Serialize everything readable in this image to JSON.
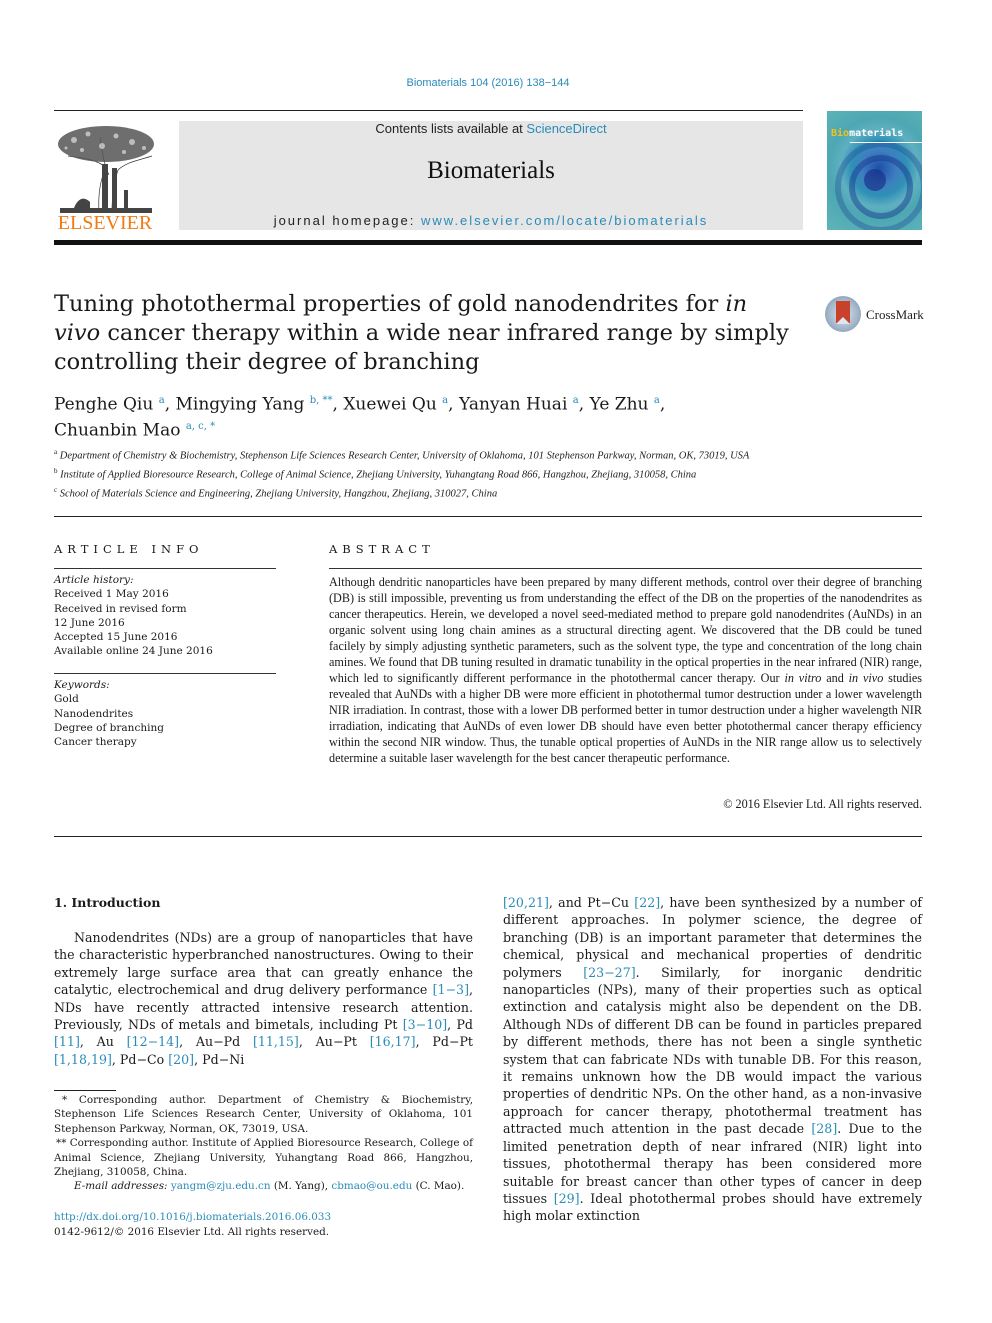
{
  "header": {
    "journal_ref": "Biomaterials 104 (2016) 138−144",
    "contents_prefix": "Contents lists available at ",
    "contents_link": "ScienceDirect",
    "journal_name": "Biomaterials",
    "homepage_prefix": "journal homepage: ",
    "homepage_link": "www.elsevier.com/locate/biomaterials",
    "publisher_logo_text": "ELSEVIER",
    "cover_title_bio": "Bio",
    "cover_title_rest": "materials",
    "crossmark_label": "CrossMark"
  },
  "article": {
    "title_part1": "Tuning photothermal properties of gold nanodendrites for ",
    "title_italic": "in vivo",
    "title_part2": " cancer therapy within a wide near infrared range by simply controlling their degree of branching",
    "authors": [
      {
        "name": "Penghe Qiu",
        "sup": "a"
      },
      {
        "name": "Mingying Yang",
        "sup": "b, **"
      },
      {
        "name": "Xuewei Qu",
        "sup": "a"
      },
      {
        "name": "Yanyan Huai",
        "sup": "a"
      },
      {
        "name": "Ye Zhu",
        "sup": "a"
      },
      {
        "name": "Chuanbin Mao",
        "sup": "a, c, *"
      }
    ],
    "affiliations": [
      {
        "sup": "a",
        "text": "Department of Chemistry & Biochemistry, Stephenson Life Sciences Research Center, University of Oklahoma, 101 Stephenson Parkway, Norman, OK, 73019, USA"
      },
      {
        "sup": "b",
        "text": "Institute of Applied Bioresource Research, College of Animal Science, Zhejiang University, Yuhangtang Road 866, Hangzhou, Zhejiang, 310058, China"
      },
      {
        "sup": "c",
        "text": "School of Materials Science and Engineering, Zhejiang University, Hangzhou, Zhejiang, 310027, China"
      }
    ]
  },
  "article_info": {
    "heading": "ARTICLE INFO",
    "history_label": "Article history:",
    "history": [
      "Received 1 May 2016",
      "Received in revised form",
      "12 June 2016",
      "Accepted 15 June 2016",
      "Available online 24 June 2016"
    ],
    "keywords_label": "Keywords:",
    "keywords": [
      "Gold",
      "Nanodendrites",
      "Degree of branching",
      "Cancer therapy"
    ]
  },
  "abstract": {
    "heading": "ABSTRACT",
    "text_1": "Although dendritic nanoparticles have been prepared by many different methods, control over their degree of branching (DB) is still impossible, preventing us from understanding the effect of the DB on the properties of the nanodendrites as cancer therapeutics. Herein, we developed a novel seed-mediated method to prepare gold nanodendrites (AuNDs) in an organic solvent using long chain amines as a structural directing agent. We discovered that the DB could be tuned facilely by simply adjusting synthetic parameters, such as the solvent type, the type and concentration of the long chain amines. We found that DB tuning resulted in dramatic tunability in the optical properties in the near infrared (NIR) range, which led to significantly different performance in the photothermal cancer therapy. Our ",
    "italic_1": "in vitro",
    "text_2": " and ",
    "italic_2": "in vivo",
    "text_3": " studies revealed that AuNDs with a higher DB were more efficient in photothermal tumor destruction under a lower wavelength NIR irradiation. In contrast, those with a lower DB performed better in tumor destruction under a higher wavelength NIR irradiation, indicating that AuNDs of even lower DB should have even better photothermal cancer therapy efficiency within the second NIR window. Thus, the tunable optical properties of AuNDs in the NIR range allow us to selectively determine a suitable laser wavelength for the best cancer therapeutic performance.",
    "copyright": "© 2016 Elsevier Ltd. All rights reserved."
  },
  "body": {
    "section_heading": "1.  Introduction",
    "left_col": [
      {
        "t": "Nanodendrites (NDs) are a group of nanoparticles that have the characteristic hyperbranched nanostructures. Owing to their extremely large surface area that can greatly enhance the catalytic, electrochemical and drug delivery performance "
      },
      {
        "c": "[1−3]"
      },
      {
        "t": ", NDs have recently attracted intensive research attention. Previously, NDs of metals and bimetals, including Pt "
      },
      {
        "c": "[3−10]"
      },
      {
        "t": ", Pd "
      },
      {
        "c": "[11]"
      },
      {
        "t": ", Au "
      },
      {
        "c": "[12−14]"
      },
      {
        "t": ", Au−Pd "
      },
      {
        "c": "[11,15]"
      },
      {
        "t": ", Au−Pt "
      },
      {
        "c": "[16,17]"
      },
      {
        "t": ", Pd−Pt "
      },
      {
        "c": "[1,18,19]"
      },
      {
        "t": ", Pd−Co "
      },
      {
        "c": "[20]"
      },
      {
        "t": ", Pd−Ni"
      }
    ],
    "right_col": [
      {
        "c": "[20,21]"
      },
      {
        "t": ", and Pt−Cu "
      },
      {
        "c": "[22]"
      },
      {
        "t": ", have been synthesized by a number of different approaches. In polymer science, the degree of branching (DB) is an important parameter that determines the chemical, physical and mechanical properties of dendritic polymers "
      },
      {
        "c": "[23−27]"
      },
      {
        "t": ". Similarly, for inorganic dendritic nanoparticles (NPs), many of their properties such as optical extinction and catalysis might also be dependent on the DB. Although NDs of different DB can be found in particles prepared by different methods, there has not been a single synthetic system that can fabricate NDs with tunable DB. For this reason, it remains unknown how the DB would impact the various properties of dendritic NPs. On the other hand, as a non-invasive approach for cancer therapy, photothermal treatment has attracted much attention in the past decade "
      },
      {
        "c": "[28]"
      },
      {
        "t": ". Due to the limited penetration depth of near infrared (NIR) light into tissues, photothermal therapy has been considered more suitable for breast cancer than other types of cancer in deep tissues "
      },
      {
        "c": "[29]"
      },
      {
        "t": ". Ideal photothermal probes should have extremely high molar extinction"
      }
    ]
  },
  "footnotes": {
    "fn1": "* Corresponding author. Department of Chemistry & Biochemistry, Stephenson Life Sciences Research Center, University of Oklahoma, 101 Stephenson Parkway, Norman, OK, 73019, USA.",
    "fn2": "** Corresponding author. Institute of Applied Bioresource Research, College of Animal Science, Zhejiang University, Yuhangtang Road 866, Hangzhou, Zhejiang, 310058, China.",
    "email_label": "E-mail addresses:",
    "email_1": "yangm@zju.edu.cn",
    "email_1_name": " (M. Yang), ",
    "email_2": "cbmao@ou.edu",
    "email_2_name": " (C. Mao).",
    "doi": "http://dx.doi.org/10.1016/j.biomaterials.2016.06.033",
    "issn": "0142-9612/© 2016 Elsevier Ltd. All rights reserved."
  }
}
